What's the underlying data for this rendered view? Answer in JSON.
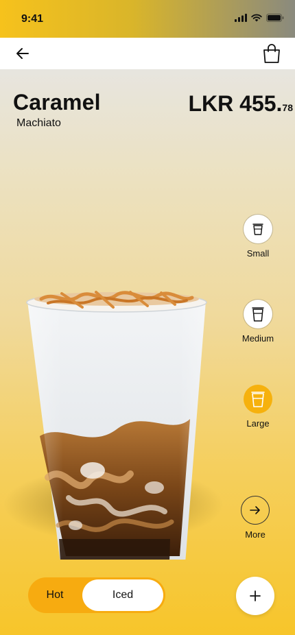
{
  "status": {
    "time": "9:41"
  },
  "product": {
    "name": "Caramel",
    "subtitle": "Machiato",
    "price_main": "LKR 455.",
    "price_cents": "78"
  },
  "sizes": [
    {
      "label": "Small",
      "selected": false
    },
    {
      "label": "Medium",
      "selected": false
    },
    {
      "label": "Large",
      "selected": true
    }
  ],
  "more": {
    "label": "More"
  },
  "temperature": {
    "hot_label": "Hot",
    "iced_label": "Iced",
    "selected": "Iced"
  },
  "colors": {
    "accent": "#f6b10d",
    "toggle_bg": "#f7ab10",
    "text": "#111111"
  }
}
